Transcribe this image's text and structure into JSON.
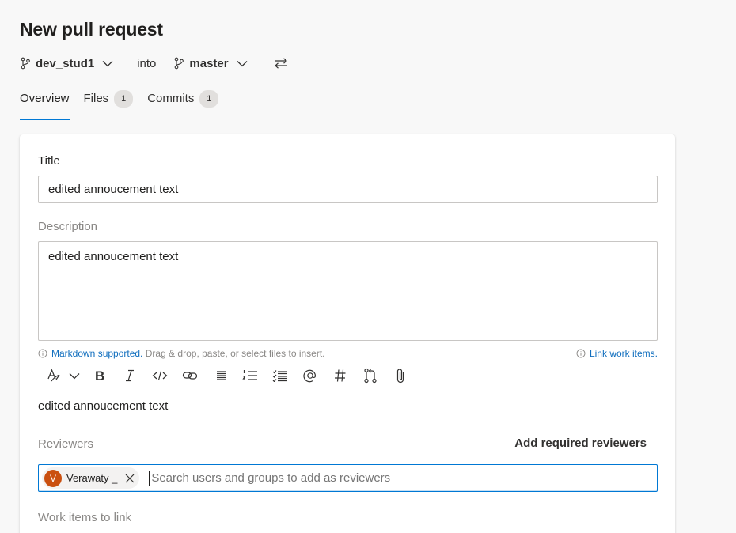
{
  "page": {
    "title": "New pull request"
  },
  "branches": {
    "source": "dev_stud1",
    "into_label": "into",
    "target": "master"
  },
  "tabs": [
    {
      "label": "Overview"
    },
    {
      "label": "Files",
      "count": "1"
    },
    {
      "label": "Commits",
      "count": "1"
    }
  ],
  "form": {
    "title_label": "Title",
    "title_value": "edited annoucement text",
    "description_label": "Description",
    "description_value": "edited annoucement text",
    "markdown_link": "Markdown supported.",
    "markdown_hint": " Drag & drop, paste, or select files to insert.",
    "link_work_items": "Link work items.",
    "preview_text": "edited annoucement text",
    "reviewers_label": "Reviewers",
    "add_required_reviewers": "Add required reviewers",
    "reviewer_chip": {
      "initial": "V",
      "name": "Verawaty _"
    },
    "reviewer_search_placeholder": "Search users and groups to add as reviewers",
    "work_items_label": "Work items to link"
  },
  "toolbar_icons": [
    "format-icon",
    "chevron-down-icon",
    "bold-icon",
    "italic-icon",
    "code-icon",
    "link-icon",
    "bulleted-list-icon",
    "numbered-list-icon",
    "checklist-icon",
    "mention-icon",
    "hashtag-icon",
    "pull-request-icon",
    "attachment-icon"
  ],
  "colors": {
    "accent": "#0078d4",
    "link": "#106ebe",
    "avatar": "#ca5010"
  }
}
